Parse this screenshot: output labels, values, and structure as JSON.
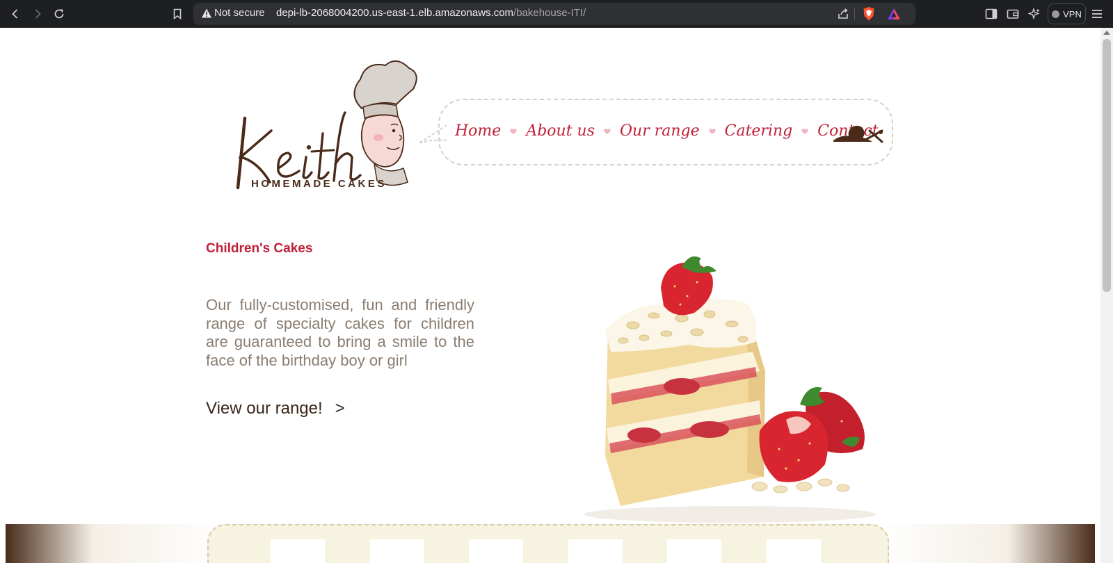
{
  "browser": {
    "security_label": "Not secure",
    "url_host": "depi-lb-2068004200.us-east-1.elb.amazonaws.com",
    "url_path": "/bakehouse-ITI/",
    "vpn_label": "VPN",
    "icons": [
      "back-icon",
      "forward-icon",
      "reload-icon",
      "bookmark-icon",
      "warning-icon",
      "share-icon",
      "brave-shield-icon",
      "brave-rewards-icon",
      "sidebar-icon",
      "wallet-icon",
      "leo-ai-icon",
      "menu-icon"
    ]
  },
  "site": {
    "logo_text": "Keith",
    "logo_sub": "HOMEMADE CAKES",
    "nav": [
      {
        "label": "Home"
      },
      {
        "label": "About us"
      },
      {
        "label": "Our range"
      },
      {
        "label": "Catering"
      },
      {
        "label": "Contact"
      }
    ]
  },
  "hero": {
    "title": "Children's Cakes",
    "text": "Our fully-customised, fun and friendly range of specialty cakes for children are guaranteed to bring a smile to the face of the birthday boy or girl",
    "cta": "View our range!",
    "cta_arrow": ">"
  },
  "colors": {
    "brand_red": "#c0213a",
    "brand_brown": "#4a2b1a",
    "body_text": "#8a7d70"
  }
}
